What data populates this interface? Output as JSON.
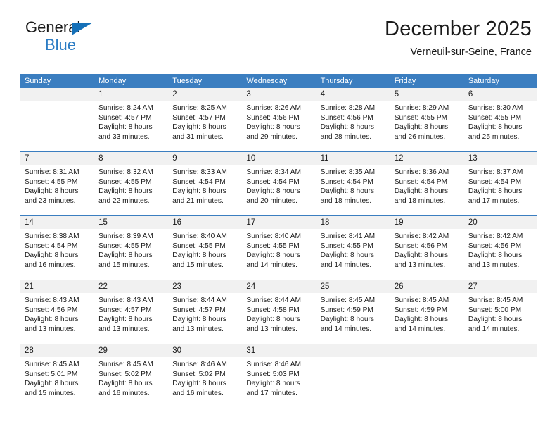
{
  "brand": {
    "name_top": "General",
    "name_bottom": "Blue",
    "accent_color": "#2b7cc4",
    "triangle_color": "#1570b8"
  },
  "header": {
    "title": "December 2025",
    "subtitle": "Verneuil-sur-Seine, France"
  },
  "calendar": {
    "header_bg": "#3b7ec0",
    "daynum_bg": "#f1f1f1",
    "weekdays": [
      "Sunday",
      "Monday",
      "Tuesday",
      "Wednesday",
      "Thursday",
      "Friday",
      "Saturday"
    ],
    "weeks": [
      [
        {
          "day": "",
          "sunrise": "",
          "sunset": "",
          "daylight": ""
        },
        {
          "day": "1",
          "sunrise": "Sunrise: 8:24 AM",
          "sunset": "Sunset: 4:57 PM",
          "daylight": "Daylight: 8 hours and 33 minutes."
        },
        {
          "day": "2",
          "sunrise": "Sunrise: 8:25 AM",
          "sunset": "Sunset: 4:57 PM",
          "daylight": "Daylight: 8 hours and 31 minutes."
        },
        {
          "day": "3",
          "sunrise": "Sunrise: 8:26 AM",
          "sunset": "Sunset: 4:56 PM",
          "daylight": "Daylight: 8 hours and 29 minutes."
        },
        {
          "day": "4",
          "sunrise": "Sunrise: 8:28 AM",
          "sunset": "Sunset: 4:56 PM",
          "daylight": "Daylight: 8 hours and 28 minutes."
        },
        {
          "day": "5",
          "sunrise": "Sunrise: 8:29 AM",
          "sunset": "Sunset: 4:55 PM",
          "daylight": "Daylight: 8 hours and 26 minutes."
        },
        {
          "day": "6",
          "sunrise": "Sunrise: 8:30 AM",
          "sunset": "Sunset: 4:55 PM",
          "daylight": "Daylight: 8 hours and 25 minutes."
        }
      ],
      [
        {
          "day": "7",
          "sunrise": "Sunrise: 8:31 AM",
          "sunset": "Sunset: 4:55 PM",
          "daylight": "Daylight: 8 hours and 23 minutes."
        },
        {
          "day": "8",
          "sunrise": "Sunrise: 8:32 AM",
          "sunset": "Sunset: 4:55 PM",
          "daylight": "Daylight: 8 hours and 22 minutes."
        },
        {
          "day": "9",
          "sunrise": "Sunrise: 8:33 AM",
          "sunset": "Sunset: 4:54 PM",
          "daylight": "Daylight: 8 hours and 21 minutes."
        },
        {
          "day": "10",
          "sunrise": "Sunrise: 8:34 AM",
          "sunset": "Sunset: 4:54 PM",
          "daylight": "Daylight: 8 hours and 20 minutes."
        },
        {
          "day": "11",
          "sunrise": "Sunrise: 8:35 AM",
          "sunset": "Sunset: 4:54 PM",
          "daylight": "Daylight: 8 hours and 18 minutes."
        },
        {
          "day": "12",
          "sunrise": "Sunrise: 8:36 AM",
          "sunset": "Sunset: 4:54 PM",
          "daylight": "Daylight: 8 hours and 18 minutes."
        },
        {
          "day": "13",
          "sunrise": "Sunrise: 8:37 AM",
          "sunset": "Sunset: 4:54 PM",
          "daylight": "Daylight: 8 hours and 17 minutes."
        }
      ],
      [
        {
          "day": "14",
          "sunrise": "Sunrise: 8:38 AM",
          "sunset": "Sunset: 4:54 PM",
          "daylight": "Daylight: 8 hours and 16 minutes."
        },
        {
          "day": "15",
          "sunrise": "Sunrise: 8:39 AM",
          "sunset": "Sunset: 4:55 PM",
          "daylight": "Daylight: 8 hours and 15 minutes."
        },
        {
          "day": "16",
          "sunrise": "Sunrise: 8:40 AM",
          "sunset": "Sunset: 4:55 PM",
          "daylight": "Daylight: 8 hours and 15 minutes."
        },
        {
          "day": "17",
          "sunrise": "Sunrise: 8:40 AM",
          "sunset": "Sunset: 4:55 PM",
          "daylight": "Daylight: 8 hours and 14 minutes."
        },
        {
          "day": "18",
          "sunrise": "Sunrise: 8:41 AM",
          "sunset": "Sunset: 4:55 PM",
          "daylight": "Daylight: 8 hours and 14 minutes."
        },
        {
          "day": "19",
          "sunrise": "Sunrise: 8:42 AM",
          "sunset": "Sunset: 4:56 PM",
          "daylight": "Daylight: 8 hours and 13 minutes."
        },
        {
          "day": "20",
          "sunrise": "Sunrise: 8:42 AM",
          "sunset": "Sunset: 4:56 PM",
          "daylight": "Daylight: 8 hours and 13 minutes."
        }
      ],
      [
        {
          "day": "21",
          "sunrise": "Sunrise: 8:43 AM",
          "sunset": "Sunset: 4:56 PM",
          "daylight": "Daylight: 8 hours and 13 minutes."
        },
        {
          "day": "22",
          "sunrise": "Sunrise: 8:43 AM",
          "sunset": "Sunset: 4:57 PM",
          "daylight": "Daylight: 8 hours and 13 minutes."
        },
        {
          "day": "23",
          "sunrise": "Sunrise: 8:44 AM",
          "sunset": "Sunset: 4:57 PM",
          "daylight": "Daylight: 8 hours and 13 minutes."
        },
        {
          "day": "24",
          "sunrise": "Sunrise: 8:44 AM",
          "sunset": "Sunset: 4:58 PM",
          "daylight": "Daylight: 8 hours and 13 minutes."
        },
        {
          "day": "25",
          "sunrise": "Sunrise: 8:45 AM",
          "sunset": "Sunset: 4:59 PM",
          "daylight": "Daylight: 8 hours and 14 minutes."
        },
        {
          "day": "26",
          "sunrise": "Sunrise: 8:45 AM",
          "sunset": "Sunset: 4:59 PM",
          "daylight": "Daylight: 8 hours and 14 minutes."
        },
        {
          "day": "27",
          "sunrise": "Sunrise: 8:45 AM",
          "sunset": "Sunset: 5:00 PM",
          "daylight": "Daylight: 8 hours and 14 minutes."
        }
      ],
      [
        {
          "day": "28",
          "sunrise": "Sunrise: 8:45 AM",
          "sunset": "Sunset: 5:01 PM",
          "daylight": "Daylight: 8 hours and 15 minutes."
        },
        {
          "day": "29",
          "sunrise": "Sunrise: 8:45 AM",
          "sunset": "Sunset: 5:02 PM",
          "daylight": "Daylight: 8 hours and 16 minutes."
        },
        {
          "day": "30",
          "sunrise": "Sunrise: 8:46 AM",
          "sunset": "Sunset: 5:02 PM",
          "daylight": "Daylight: 8 hours and 16 minutes."
        },
        {
          "day": "31",
          "sunrise": "Sunrise: 8:46 AM",
          "sunset": "Sunset: 5:03 PM",
          "daylight": "Daylight: 8 hours and 17 minutes."
        },
        {
          "day": "",
          "sunrise": "",
          "sunset": "",
          "daylight": ""
        },
        {
          "day": "",
          "sunrise": "",
          "sunset": "",
          "daylight": ""
        },
        {
          "day": "",
          "sunrise": "",
          "sunset": "",
          "daylight": ""
        }
      ]
    ]
  }
}
